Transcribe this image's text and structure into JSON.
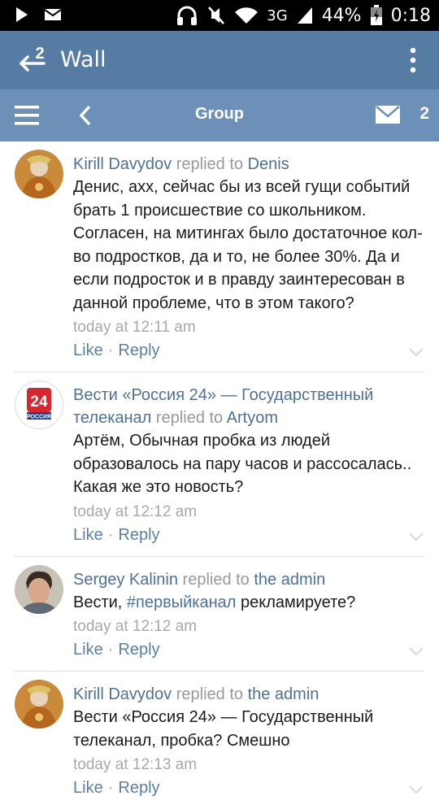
{
  "status_bar": {
    "network": "3G",
    "battery": "44%",
    "time": "0:18"
  },
  "app_bar": {
    "badge": "2",
    "title": "Wall"
  },
  "group_bar": {
    "title": "Group",
    "message_count": "2"
  },
  "comments": [
    {
      "author": "Kirill Davydov",
      "replied": "replied to",
      "target": "Denis",
      "text": "Денис, ахх, сейчас бы из всей гущи событий брать 1 происшествие со школьником. Согласен, на митингах было достаточное кол-во подростков, да и то, не более 30%. Да и если подросток и в правду заинтересован в данной проблеме, что в этом такого?",
      "time": "today at 12:11 am",
      "like": "Like",
      "reply": "Reply"
    },
    {
      "author": "Вести «Россия 24» — Государственный телеканал",
      "replied": "replied to",
      "target": "Artyom",
      "text": "Артём, Обычная пробка из людей образовалось на пару часов и рассосалась.. Какая же это новость?",
      "time": "today at 12:12 am",
      "like": "Like",
      "reply": "Reply",
      "logo_number": "24",
      "logo_caption": "РОССИЯ"
    },
    {
      "author": "Sergey Kalinin",
      "replied": "replied to",
      "target": "the admin",
      "text_prefix": "Вести, ",
      "hashtag": "#первыйканал",
      "text_suffix": " рекламируете?",
      "time": "today at 12:12 am",
      "like": "Like",
      "reply": "Reply"
    },
    {
      "author": "Kirill Davydov",
      "replied": "replied to",
      "target": "the admin",
      "text": "Вести «Россия 24» — Государственный телеканал, пробка? Смешно",
      "time": "today at 12:13 am",
      "like": "Like",
      "reply": "Reply"
    }
  ],
  "colors": {
    "app_bar": "#567ca4",
    "group_bar": "#6d90b8",
    "link": "#4d7199"
  }
}
